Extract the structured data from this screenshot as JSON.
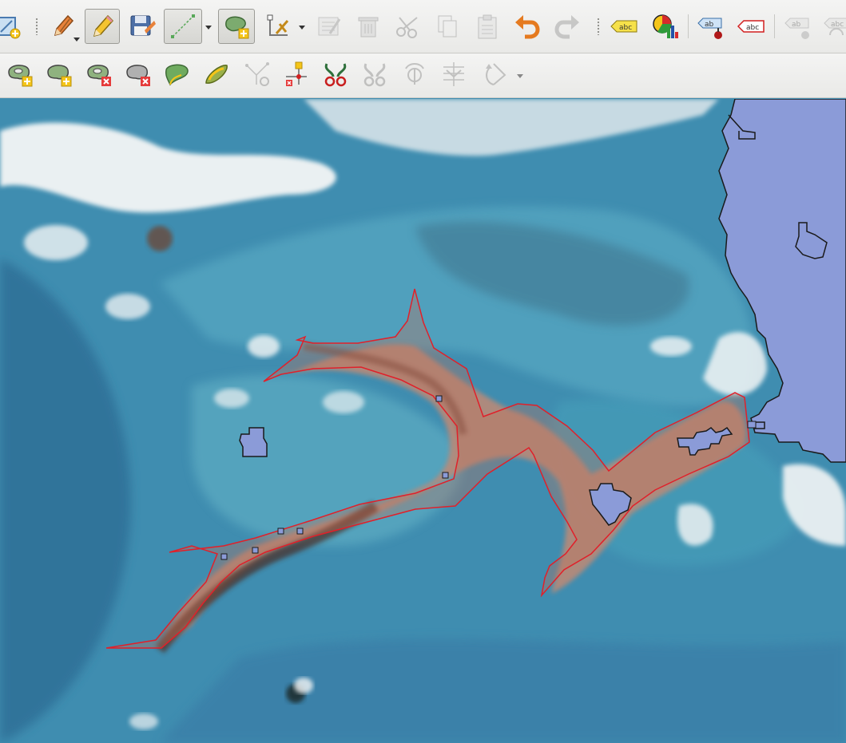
{
  "toolbar_top": {
    "buttons": [
      {
        "name": "new-layer-button",
        "icon": "new-layer-icon",
        "state": "normal"
      },
      {
        "name": "edit-pencil-orange-button",
        "icon": "edit-pencil-icon",
        "state": "normal"
      },
      {
        "name": "toggle-editing-button",
        "icon": "pencil-icon",
        "state": "active"
      },
      {
        "name": "save-edits-button",
        "icon": "floppy-disk-icon",
        "state": "normal"
      },
      {
        "name": "digitize-line-button",
        "icon": "line-digitize-icon",
        "state": "active"
      },
      {
        "name": "add-polygon-button",
        "icon": "add-polygon-icon",
        "state": "active"
      },
      {
        "name": "vertex-tool-button",
        "icon": "vertex-tool-icon",
        "state": "normal"
      },
      {
        "name": "modify-attributes-button",
        "icon": "modify-attributes-icon",
        "state": "disabled"
      },
      {
        "name": "delete-selected-button",
        "icon": "trash-icon",
        "state": "disabled"
      },
      {
        "name": "cut-features-button",
        "icon": "scissors-icon",
        "state": "disabled"
      },
      {
        "name": "copy-features-button",
        "icon": "copy-icon",
        "state": "disabled"
      },
      {
        "name": "paste-features-button",
        "icon": "paste-icon",
        "state": "disabled"
      },
      {
        "name": "undo-button",
        "icon": "undo-icon",
        "state": "normal"
      },
      {
        "name": "redo-button",
        "icon": "redo-icon",
        "state": "disabled"
      },
      {
        "name": "layer-labeling-button",
        "icon": "label-yellow-icon",
        "state": "normal"
      },
      {
        "name": "layer-diagram-button",
        "icon": "diagram-icon",
        "state": "normal"
      },
      {
        "name": "pin-labels-button",
        "icon": "pin-label-icon",
        "state": "normal"
      },
      {
        "name": "highlight-labels-button",
        "icon": "label-red-icon",
        "state": "normal"
      },
      {
        "name": "move-label-button",
        "icon": "label-gray-icon",
        "state": "disabled"
      },
      {
        "name": "rotate-label-button",
        "icon": "label-gray-icon",
        "state": "disabled"
      }
    ],
    "label_text": "abc",
    "pin_label_text": "ab"
  },
  "toolbar_bottom": {
    "buttons": [
      {
        "name": "add-ring-button",
        "icon": "add-ring-icon",
        "state": "normal"
      },
      {
        "name": "add-part-button",
        "icon": "add-part-icon",
        "state": "normal"
      },
      {
        "name": "delete-ring-button",
        "icon": "delete-ring-icon",
        "state": "normal"
      },
      {
        "name": "delete-part-button",
        "icon": "delete-part-icon",
        "state": "normal"
      },
      {
        "name": "reshape-features-button",
        "icon": "reshape-icon",
        "state": "normal"
      },
      {
        "name": "offset-curve-button",
        "icon": "offset-curve-icon",
        "state": "normal"
      },
      {
        "name": "simplify-feature-button",
        "icon": "simplify-icon",
        "state": "disabled"
      },
      {
        "name": "split-features-button",
        "icon": "split-features-icon",
        "state": "normal"
      },
      {
        "name": "merge-features-button",
        "icon": "merge-scissors-icon",
        "state": "normal"
      },
      {
        "name": "merge-attributes-button",
        "icon": "merge-scissors-icon",
        "state": "disabled"
      },
      {
        "name": "rotate-point-symbols-button",
        "icon": "rotate-symbols-icon",
        "state": "disabled"
      },
      {
        "name": "offset-point-symbols-button",
        "icon": "offset-symbols-icon",
        "state": "disabled"
      },
      {
        "name": "rotate-feature-button",
        "icon": "rotate-feature-icon",
        "state": "disabled"
      }
    ]
  },
  "map": {
    "colors": {
      "water_deep": "#2f6f97",
      "water_mid": "#3f8db0",
      "water_shallow": "#5fb0c8",
      "cloud": "#f4f6f6",
      "land_polygon": "#8b9bd8",
      "channel_fill": "#b98a78",
      "channel_dark": "#4a2a24",
      "digitized_stroke": "#e0202a",
      "outline_stroke": "#1a1a1a"
    }
  }
}
